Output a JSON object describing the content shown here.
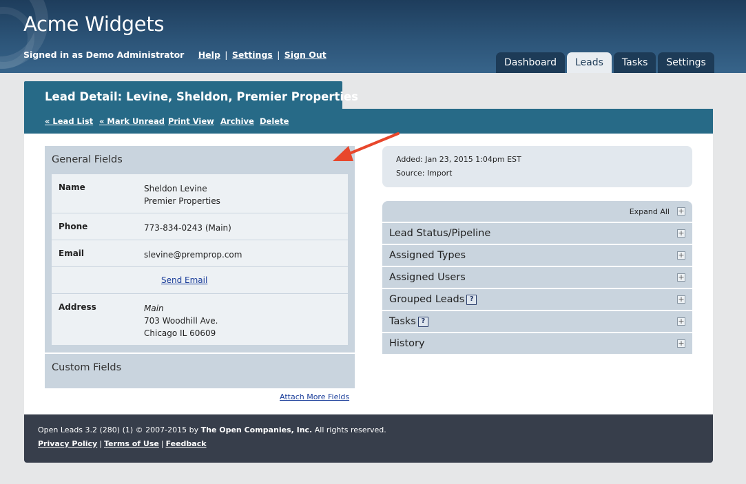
{
  "header": {
    "app_title": "Acme Widgets",
    "signed_in": "Signed in as Demo Administrator",
    "links": [
      "Help",
      "Settings",
      "Sign Out"
    ],
    "separator": "|"
  },
  "tabs": [
    {
      "label": "Dashboard",
      "active": false
    },
    {
      "label": "Leads",
      "active": true
    },
    {
      "label": "Tasks",
      "active": false
    },
    {
      "label": "Settings",
      "active": false
    }
  ],
  "lead": {
    "title": "Lead Detail: Levine, Sheldon, Premier Properties",
    "actions": [
      "« Lead List",
      "« Mark Unread",
      "Print View",
      "Archive",
      "Delete"
    ]
  },
  "general_fields": {
    "header": "General Fields",
    "name_label": "Name",
    "name_line1": "Sheldon Levine",
    "name_line2": "Premier Properties",
    "phone_label": "Phone",
    "phone_value": "773-834-0243 (Main)",
    "email_label": "Email",
    "email_value": "slevine@premprop.com",
    "send_email": "Send Email",
    "address_label": "Address",
    "address_type": "Main",
    "address_line1": "703 Woodhill Ave.",
    "address_line2": "Chicago IL 60609"
  },
  "custom_fields": {
    "header": "Custom Fields",
    "attach_more": "Attach More Fields"
  },
  "info": {
    "added": "Added: Jan 23, 2015 1:04pm EST",
    "source": "Source: Import"
  },
  "sections": {
    "expand_all": "Expand All",
    "items": [
      {
        "label": "Lead Status/Pipeline",
        "help": false
      },
      {
        "label": "Assigned Types",
        "help": false
      },
      {
        "label": "Assigned Users",
        "help": false
      },
      {
        "label": "Grouped Leads",
        "help": true
      },
      {
        "label": "Tasks",
        "help": true
      },
      {
        "label": "History",
        "help": false
      }
    ],
    "help_glyph": "?",
    "plus_glyph": "+"
  },
  "footer": {
    "version": "Open Leads 3.2 (280) (1) © 2007-2015 by",
    "company": "The Open Companies, Inc.",
    "rights": "All rights reserved.",
    "links": [
      "Privacy Policy",
      "Terms of Use",
      "Feedback"
    ]
  },
  "colors": {
    "header_bg": "#2c5478",
    "accent_teal": "#276a87",
    "panel_gray": "#c9d4de",
    "footer_bg": "#373e4b",
    "annotation_arrow": "#e8472c"
  }
}
